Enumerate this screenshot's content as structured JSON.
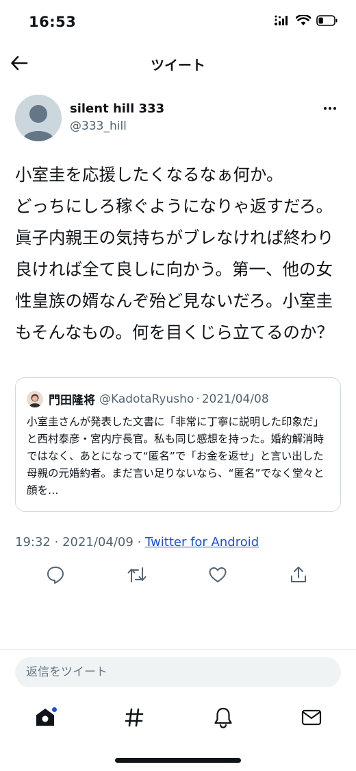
{
  "status_bar": {
    "time": "16:53",
    "battery_level": 0.3
  },
  "nav": {
    "title": "ツイート"
  },
  "tweet": {
    "author_name": "silent hill 333",
    "author_handle": "@333_hill",
    "text": "小室圭を応援したくなるなぁ何か。\nどっちにしろ稼ぐようになりゃ返すだろ。眞子内親王の気持ちがブレなければ終わり良ければ全て良しに向かう。第一、他の女性皇族の婿なんぞ殆ど見ないだろ。小室圭もそんなもの。何を目くじら立てるのか？",
    "time": "19:32",
    "date": "2021/04/09",
    "source": "Twitter for Android"
  },
  "quote": {
    "name": "門田隆将",
    "handle": "@KadotaRyusho",
    "separator": "·",
    "date": "2021/04/08",
    "text": "小室圭さんが発表した文書に「非常に丁寧に説明した印象だ」と西村泰彦・宮内庁長官。私も同じ感想を持った。婚約解消時ではなく、あとになって“匿名”で「お金を返せ」と言い出した母親の元婚約者。まだ言い足りないなら、“匿名”でなく堂々と顔を…"
  },
  "meta_separator": "·",
  "reply": {
    "placeholder": "返信をツイート"
  },
  "icons": {
    "back": "back-arrow-icon",
    "more": "more-dots-icon",
    "reply": "reply-icon",
    "retweet": "retweet-icon",
    "like": "like-icon",
    "share": "share-icon",
    "home": "home-icon",
    "explore": "hashtag-icon",
    "notifications": "bell-icon",
    "messages": "mail-icon"
  },
  "colors": {
    "link": "#1d4ed8",
    "text": "#0f1419",
    "muted": "#536471",
    "notification_dot": "#1d4ed8"
  }
}
